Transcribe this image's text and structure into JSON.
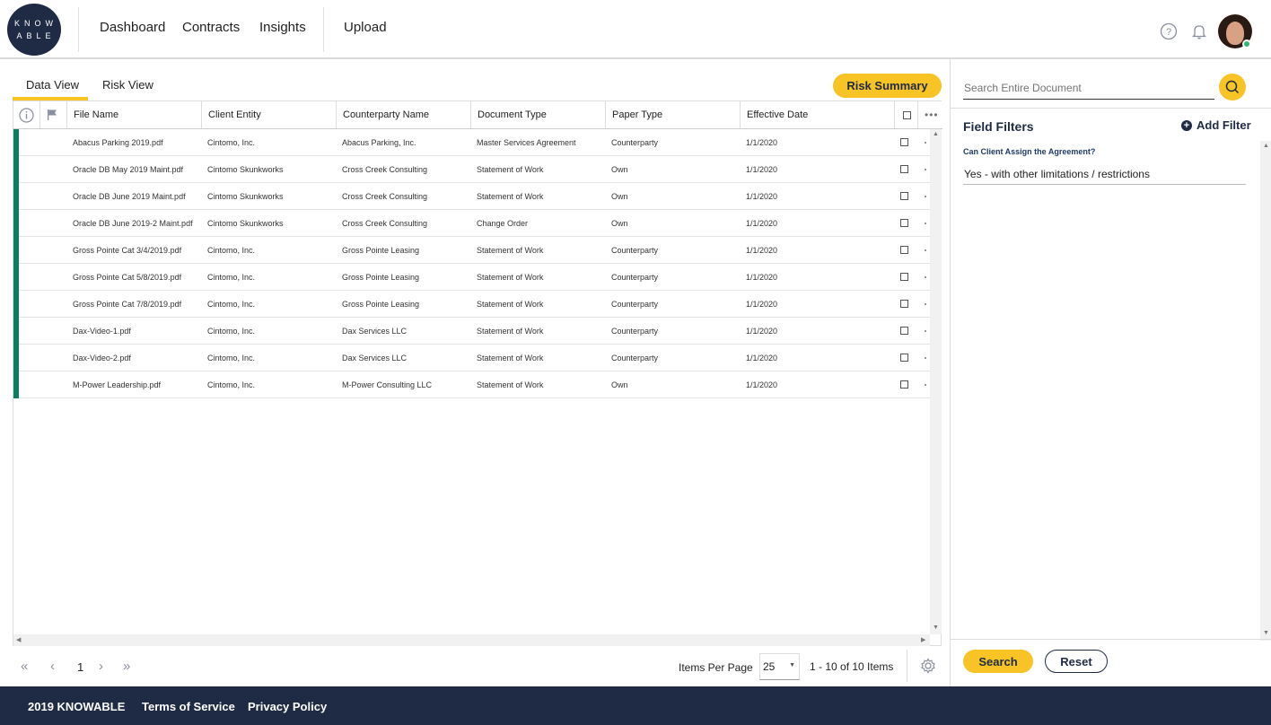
{
  "logo": {
    "line1": "KNOW",
    "line2": "ABLE"
  },
  "nav": {
    "dashboard": "Dashboard",
    "contracts": "Contracts",
    "insights": "Insights",
    "upload": "Upload"
  },
  "tabs": {
    "data_view": "Data View",
    "risk_view": "Risk View"
  },
  "risk_summary": "Risk Summary",
  "columns": {
    "file_name": "File Name",
    "client_entity": "Client Entity",
    "counterparty_name": "Counterparty Name",
    "document_type": "Document Type",
    "paper_type": "Paper Type",
    "effective_date": "Effective Date"
  },
  "rows": [
    {
      "file": "Abacus Parking 2019.pdf",
      "client": "Cintomo, Inc.",
      "counterparty": "Abacus Parking, Inc.",
      "doctype": "Master Services Agreement",
      "paper": "Counterparty",
      "date": "1/1/2020"
    },
    {
      "file": "Oracle DB May 2019 Maint.pdf",
      "client": "Cintomo Skunkworks",
      "counterparty": "Cross Creek Consulting",
      "doctype": "Statement of Work",
      "paper": "Own",
      "date": "1/1/2020"
    },
    {
      "file": "Oracle DB June 2019 Maint.pdf",
      "client": "Cintomo Skunkworks",
      "counterparty": "Cross Creek Consulting",
      "doctype": "Statement of Work",
      "paper": "Own",
      "date": "1/1/2020"
    },
    {
      "file": "Oracle DB June 2019-2 Maint.pdf",
      "client": "Cintomo Skunkworks",
      "counterparty": "Cross Creek Consulting",
      "doctype": "Change Order",
      "paper": "Own",
      "date": "1/1/2020"
    },
    {
      "file": "Gross Pointe Cat 3/4/2019.pdf",
      "client": "Cintomo, Inc.",
      "counterparty": "Gross Pointe Leasing",
      "doctype": "Statement of Work",
      "paper": "Counterparty",
      "date": "1/1/2020"
    },
    {
      "file": "Gross Pointe Cat 5/8/2019.pdf",
      "client": "Cintomo, Inc.",
      "counterparty": "Gross Pointe Leasing",
      "doctype": "Statement of Work",
      "paper": "Counterparty",
      "date": "1/1/2020"
    },
    {
      "file": "Gross Pointe Cat 7/8/2019.pdf",
      "client": "Cintomo, Inc.",
      "counterparty": "Gross Pointe Leasing",
      "doctype": "Statement of Work",
      "paper": "Counterparty",
      "date": "1/1/2020"
    },
    {
      "file": "Dax-Video-1.pdf",
      "client": "Cintomo, Inc.",
      "counterparty": "Dax Services LLC",
      "doctype": "Statement of Work",
      "paper": "Counterparty",
      "date": "1/1/2020"
    },
    {
      "file": "Dax-Video-2.pdf",
      "client": "Cintomo, Inc.",
      "counterparty": "Dax Services LLC",
      "doctype": "Statement of Work",
      "paper": "Counterparty",
      "date": "1/1/2020"
    },
    {
      "file": "M-Power Leadership.pdf",
      "client": "Cintomo, Inc.",
      "counterparty": "M-Power Consulting LLC",
      "doctype": "Statement of Work",
      "paper": "Own",
      "date": "1/1/2020"
    }
  ],
  "pager": {
    "page": "1",
    "items_per_page_label": "Items Per Page",
    "items_per_page": "25",
    "range": "1 - 10 of 10 Items"
  },
  "search": {
    "placeholder": "Search Entire Document"
  },
  "filters": {
    "title": "Field Filters",
    "add_filter": "Add Filter",
    "question": "Can Client Assign the Agreement?",
    "value": "Yes - with other limitations / restrictions"
  },
  "buttons": {
    "search": "Search",
    "reset": "Reset"
  },
  "footer": {
    "copyright": "2019 KNOWABLE",
    "terms": "Terms of Service",
    "privacy": "Privacy Policy"
  },
  "colors": {
    "accent": "#f7c325",
    "navy": "#1f2a44",
    "row_marker": "#0a7d63"
  },
  "icons": [
    "help-icon",
    "bell-icon",
    "info-icon",
    "flag-icon",
    "more-icon",
    "search-icon",
    "plus-icon",
    "gear-icon"
  ]
}
